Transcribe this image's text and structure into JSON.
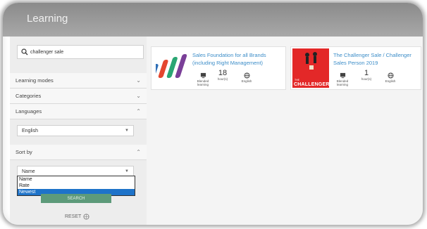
{
  "header": {
    "title": "Learning"
  },
  "search": {
    "query": "challenger sale"
  },
  "filters": [
    {
      "label": "Learning modes",
      "state": "collapsed"
    },
    {
      "label": "Categories",
      "state": "collapsed"
    },
    {
      "label": "Languages",
      "state": "expanded"
    }
  ],
  "language_select": {
    "value": "English"
  },
  "sort": {
    "label": "Sort by",
    "state": "expanded",
    "value": "Name",
    "options": [
      "Name",
      "Rate",
      "Newest"
    ],
    "highlighted": "Newest"
  },
  "search_button": {
    "label": "SEARCH"
  },
  "reset": {
    "label": "RESET"
  },
  "cards": [
    {
      "title": "Sales Foundation for all Brands (including Right Management)",
      "stats": [
        {
          "icon": "monitor-icon",
          "value": "",
          "label": "Blended learning"
        },
        {
          "icon": "clock-icon",
          "value": "18",
          "label": "hour(s)"
        },
        {
          "icon": "globe-icon",
          "value": "",
          "label": "English"
        }
      ]
    },
    {
      "title": "The Challenger Sale / Challenger Sales Person 2019",
      "cover_text": "CHALLENGER",
      "cover_subtext": "THE",
      "stats": [
        {
          "icon": "monitor-icon",
          "value": "",
          "label": "Blended learning"
        },
        {
          "icon": "clock-icon",
          "value": "1",
          "label": "hour(s)"
        },
        {
          "icon": "globe-icon",
          "value": "",
          "label": "English"
        }
      ]
    }
  ],
  "colors": {
    "accent_blue": "#3c8dc8",
    "challenger_red": "#e32828",
    "search_green": "#5d9a7a",
    "selected_blue": "#1e73c9"
  }
}
